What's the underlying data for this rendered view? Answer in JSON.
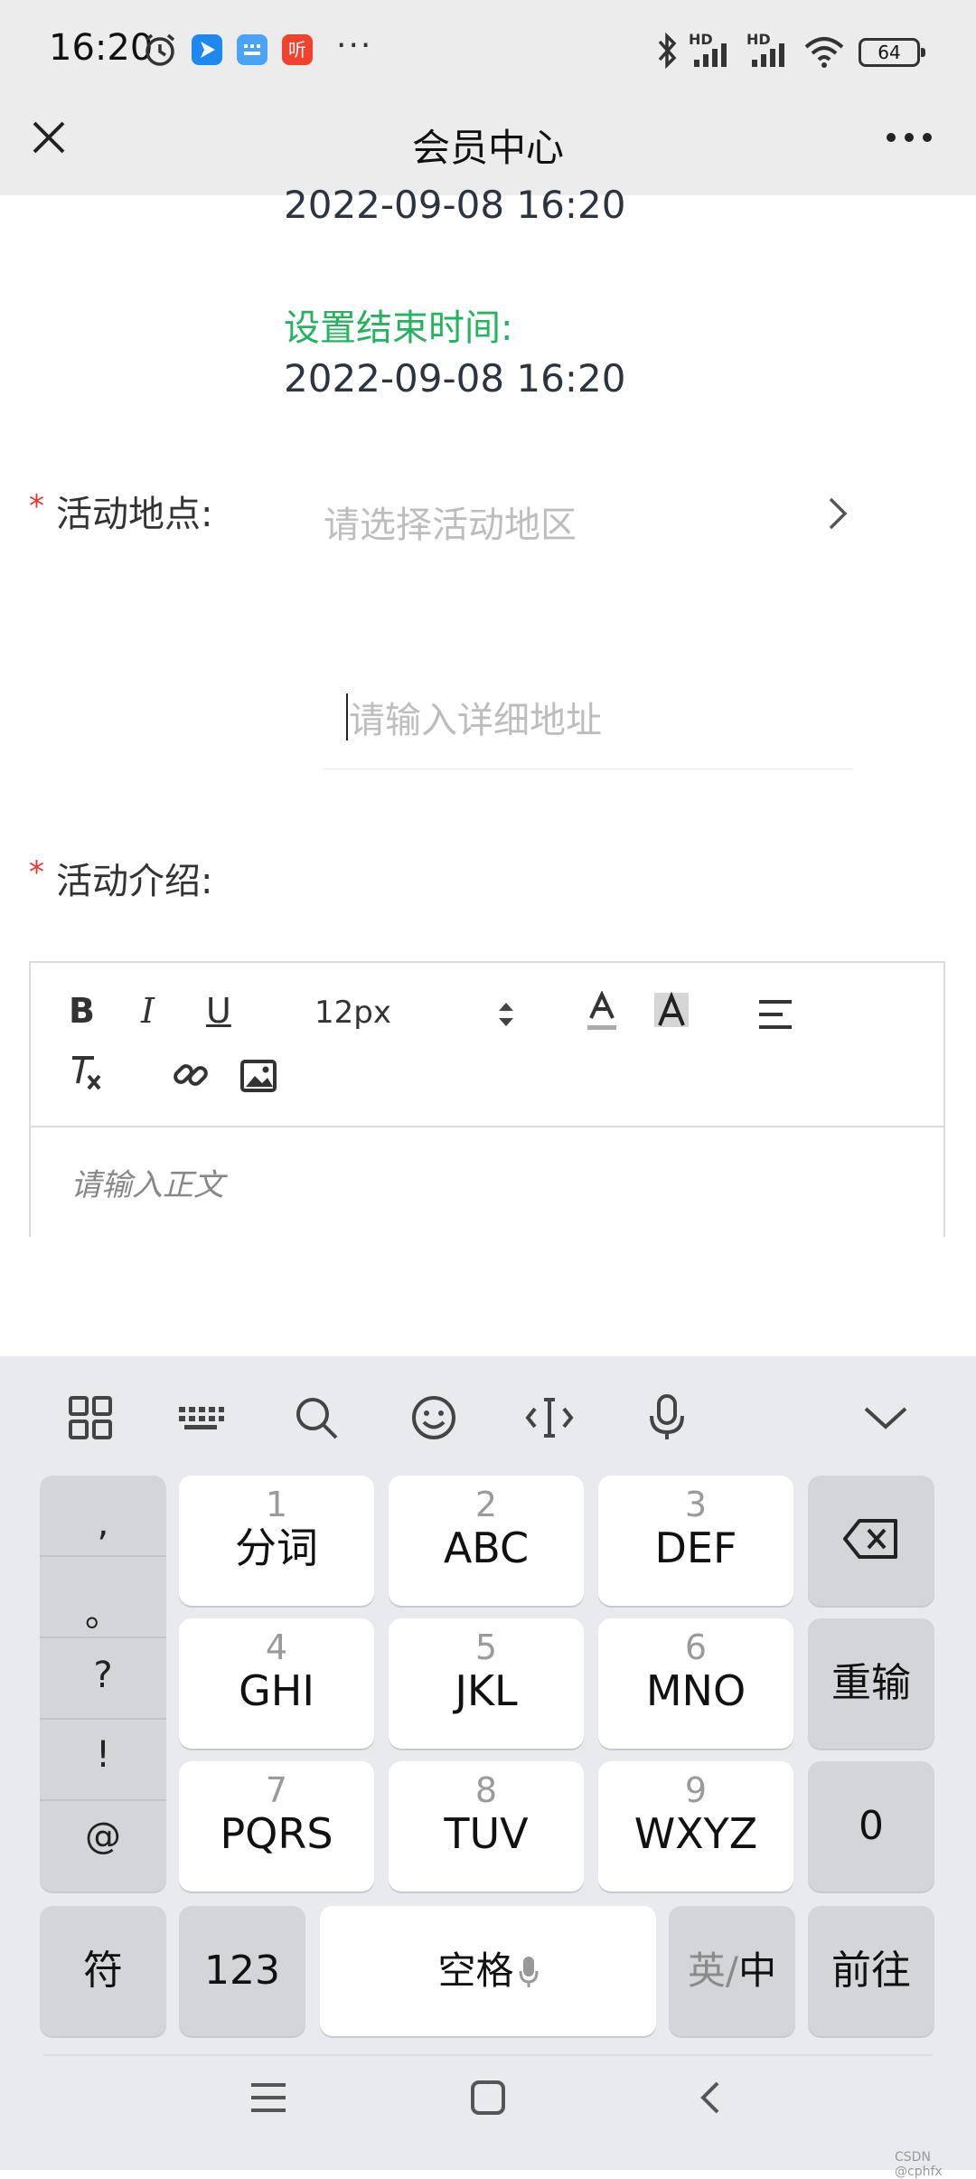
{
  "status_bar": {
    "time": "16:20",
    "icons": [
      "alarm-icon",
      "app-icon-blue",
      "app-icon-keypad",
      "app-icon-ting",
      "bluetooth-icon",
      "signal-hd-icon",
      "signal-hd-icon",
      "wifi-icon"
    ],
    "app_ting_label": "听",
    "more": "···",
    "battery": "64",
    "hd_label": "HD"
  },
  "header": {
    "title": "会员中心",
    "close_icon": "close-icon",
    "more_icon": "more-icon"
  },
  "form": {
    "start_time_value": "2022-09-08 16:20",
    "end_time_label": "设置结束时间:",
    "end_time_value": "2022-09-08 16:20",
    "required_mark": "*",
    "location_label": "活动地点:",
    "location_placeholder": "请选择活动地区",
    "address_placeholder": "请输入详细地址",
    "intro_label": "活动介绍:"
  },
  "editor": {
    "bold": "B",
    "italic": "I",
    "underline": "U",
    "font_size": "12px",
    "placeholder": "请输入正文"
  },
  "keyboard": {
    "punctuation": [
      ",",
      "。",
      "?",
      "!",
      "@"
    ],
    "keys": [
      {
        "num": "1",
        "letters": "分词"
      },
      {
        "num": "2",
        "letters": "ABC"
      },
      {
        "num": "3",
        "letters": "DEF"
      },
      {
        "num": "4",
        "letters": "GHI"
      },
      {
        "num": "5",
        "letters": "JKL"
      },
      {
        "num": "6",
        "letters": "MNO"
      },
      {
        "num": "7",
        "letters": "PQRS"
      },
      {
        "num": "8",
        "letters": "TUV"
      },
      {
        "num": "9",
        "letters": "WXYZ"
      }
    ],
    "reinput": "重输",
    "zero": "0",
    "symbols": "符",
    "numbers": "123",
    "space": "空格",
    "lang_en": "英",
    "lang_sep": "/",
    "lang_zh": "中",
    "go": "前往"
  },
  "watermark": "CSDN @cphfx",
  "colors": {
    "accent_green": "#23b45d",
    "required_red": "#e33333",
    "header_bg": "#ececec",
    "keyboard_bg": "#e9eaee"
  }
}
